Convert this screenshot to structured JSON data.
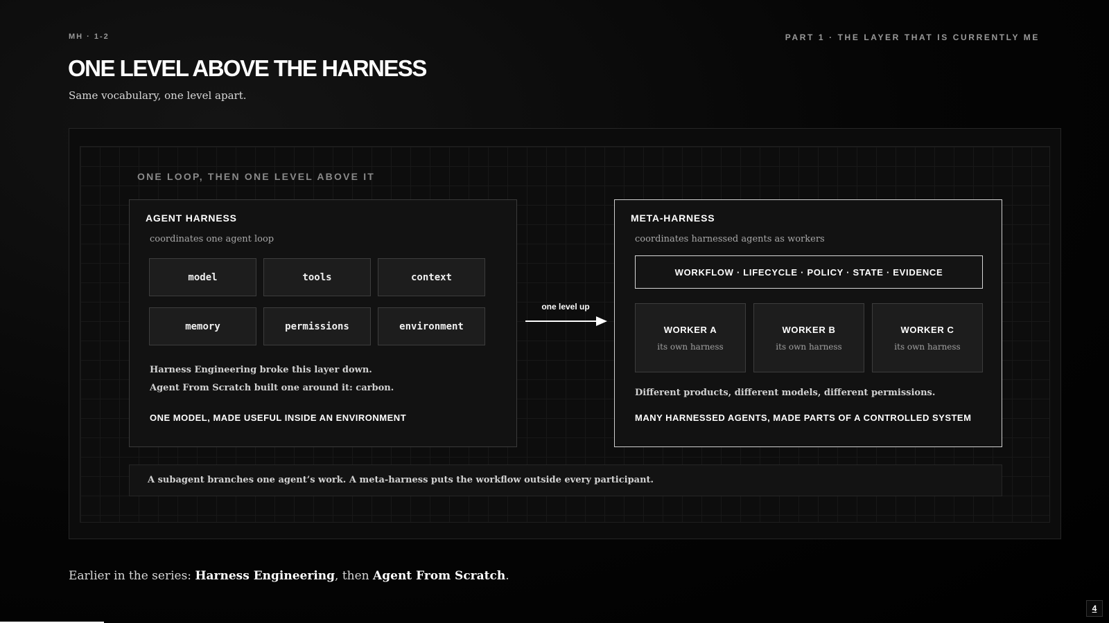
{
  "header": {
    "eyebrow": "MH · 1-2",
    "part": "PART 1 · THE LAYER THAT IS CURRENTLY ME",
    "title": "ONE LEVEL ABOVE THE HARNESS",
    "subtitle": "Same vocabulary, one level apart."
  },
  "diagram": {
    "heading": "ONE LOOP, THEN ONE LEVEL ABOVE IT",
    "agent_harness": {
      "title": "AGENT HARNESS",
      "subtitle": "coordinates one agent loop",
      "chips": [
        "model",
        "tools",
        "context",
        "memory",
        "permissions",
        "environment"
      ],
      "line1": "Harness Engineering broke this layer down.",
      "line2": "Agent From Scratch built one around it: carbon.",
      "tagline": "ONE MODEL, MADE USEFUL INSIDE AN ENVIRONMENT"
    },
    "arrow_label": "one level up",
    "meta_harness": {
      "title": "META-HARNESS",
      "subtitle": "coordinates harnessed agents as workers",
      "bar": "WORKFLOW · LIFECYCLE · POLICY · STATE · EVIDENCE",
      "workers": [
        {
          "name": "WORKER A",
          "sub": "its own harness"
        },
        {
          "name": "WORKER B",
          "sub": "its own harness"
        },
        {
          "name": "WORKER C",
          "sub": "its own harness"
        }
      ],
      "line1": "Different products, different models, different permissions.",
      "tagline": "MANY HARNESSED AGENTS, MADE PARTS OF A CONTROLLED SYSTEM"
    },
    "note": "A subagent branches one agent’s work. A meta-harness puts the workflow outside every participant."
  },
  "footer": {
    "prefix": "Earlier in the series: ",
    "link1": "Harness Engineering",
    "middle": ", then ",
    "link2": "Agent From Scratch",
    "suffix": "."
  },
  "page_number": "4",
  "colors": {
    "background": "#000000",
    "panel": "#0c0c0c",
    "chip": "#1d1d1d",
    "accent": "#ffffff",
    "muted": "#9a9a9a"
  }
}
